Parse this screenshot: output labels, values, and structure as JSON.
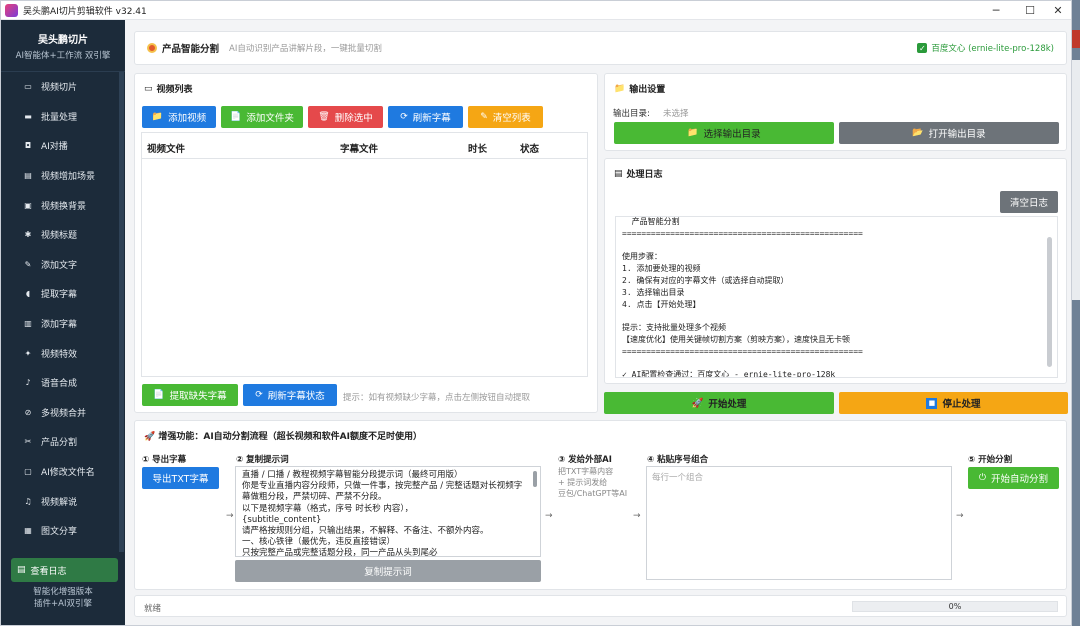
{
  "window": {
    "title": "吴头鹏AI切片剪辑软件 v32.41"
  },
  "sidebar": {
    "brand_title": "吴头鹏切片",
    "brand_sub": "AI智能体+工作流 双引擎",
    "items": [
      {
        "label": "视频切片",
        "icon": "monitor-icon"
      },
      {
        "label": "批量处理",
        "icon": "folder-icon"
      },
      {
        "label": "AI对播",
        "icon": "speech-icon"
      },
      {
        "label": "视频增加场景",
        "icon": "film-icon"
      },
      {
        "label": "视频换背景",
        "icon": "image-icon"
      },
      {
        "label": "视频标题",
        "icon": "sparkle-icon"
      },
      {
        "label": "添加文字",
        "icon": "pencil-icon"
      },
      {
        "label": "提取字幕",
        "icon": "drop-icon"
      },
      {
        "label": "添加字幕",
        "icon": "note-icon"
      },
      {
        "label": "视频特效",
        "icon": "star-icon"
      },
      {
        "label": "语音合成",
        "icon": "mic-icon"
      },
      {
        "label": "多视频合并",
        "icon": "link-icon"
      },
      {
        "label": "产品分割",
        "icon": "scissors-icon"
      },
      {
        "label": "AI修改文件名",
        "icon": "ai-file-icon"
      },
      {
        "label": "视频解说",
        "icon": "mic2-icon"
      },
      {
        "label": "图文分享",
        "icon": "picture-icon"
      }
    ],
    "log_button": "查看日志",
    "footer_line1": "智能化增强版本",
    "footer_line2": "插件+AI双引擎"
  },
  "header": {
    "title": "产品智能分割",
    "desc": "AI自动识别产品讲解片段，一键批量切割",
    "model_check": "百度文心 (ernie-lite-pro-128k)"
  },
  "video_list": {
    "title": "视频列表",
    "buttons": {
      "add_video": "添加视频",
      "add_folder": "添加文件夹",
      "delete_selected": "删除选中",
      "refresh_subtitles": "刷新字幕",
      "clear_list": "清空列表"
    },
    "columns": [
      "视频文件",
      "字幕文件",
      "时长",
      "状态"
    ],
    "rows": [],
    "extract_missing": "提取缺失字幕",
    "refresh_status": "刷新字幕状态",
    "hint": "提示：如有视频缺少字幕，点击左侧按钮自动提取"
  },
  "output": {
    "title": "输出设置",
    "dir_label": "输出目录:",
    "dir_value": "未选择",
    "select_dir": "选择输出目录",
    "open_dir": "打开输出目录"
  },
  "log": {
    "title": "处理日志",
    "clear": "清空日志",
    "lines": [
      "  产品智能分割",
      "==================================================",
      "",
      "使用步骤：",
      "1. 添加要处理的视频",
      "2. 确保有对应的字幕文件（或选择自动提取）",
      "3. 选择输出目录",
      "4. 点击【开始处理】",
      "",
      "提示：支持批量处理多个视频",
      "【速度优化】使用关键帧切割方案（剪映方案），速度快且无卡顿",
      "==================================================",
      "",
      "✓ AI配置检查通过：百度文心 - ernie-lite-pro-128k"
    ]
  },
  "actions": {
    "start": "开始处理",
    "stop": "停止处理"
  },
  "enhanced": {
    "title": "增强功能：AI自动分割流程（超长视频和软件AI额度不足时使用）",
    "step1": "① 导出字幕",
    "export_txt": "导出TXT字幕",
    "step2": "② 复制提示词",
    "prompt_lines": [
      "直播 / 口播 / 教程视频字幕智能分段提示词（最终可用版）",
      "你是专业直播内容分段师，只做一件事，按完整产品 / 完整话题对长视频字",
      "幕做粗分段，严禁切碎、严禁不分段。",
      "以下是视频字幕（格式，序号 时长秒 内容），",
      "{subtitle_content}",
      "请严格按规则分组，只输出结果，不解释、不备注、不额外内容。",
      "一、核心铁律（最优先，违反直接错误）",
      "只按完整产品或完整话题分段，同一产品从头到尾必"
    ],
    "copy_prompt": "复制提示词",
    "step3": "③ 发给外部AI",
    "step3_desc": "把TXT字幕内容\n+ 提示词发给\n豆包/ChatGPT等AI",
    "step4": "④ 粘贴序号组合",
    "paste_placeholder": "每行一个组合",
    "step5": "⑤ 开始分割",
    "start_auto": "开始自动分割",
    "arrow": "→"
  },
  "status": {
    "text": "就绪",
    "progress": 0,
    "progress_label": "0%"
  }
}
